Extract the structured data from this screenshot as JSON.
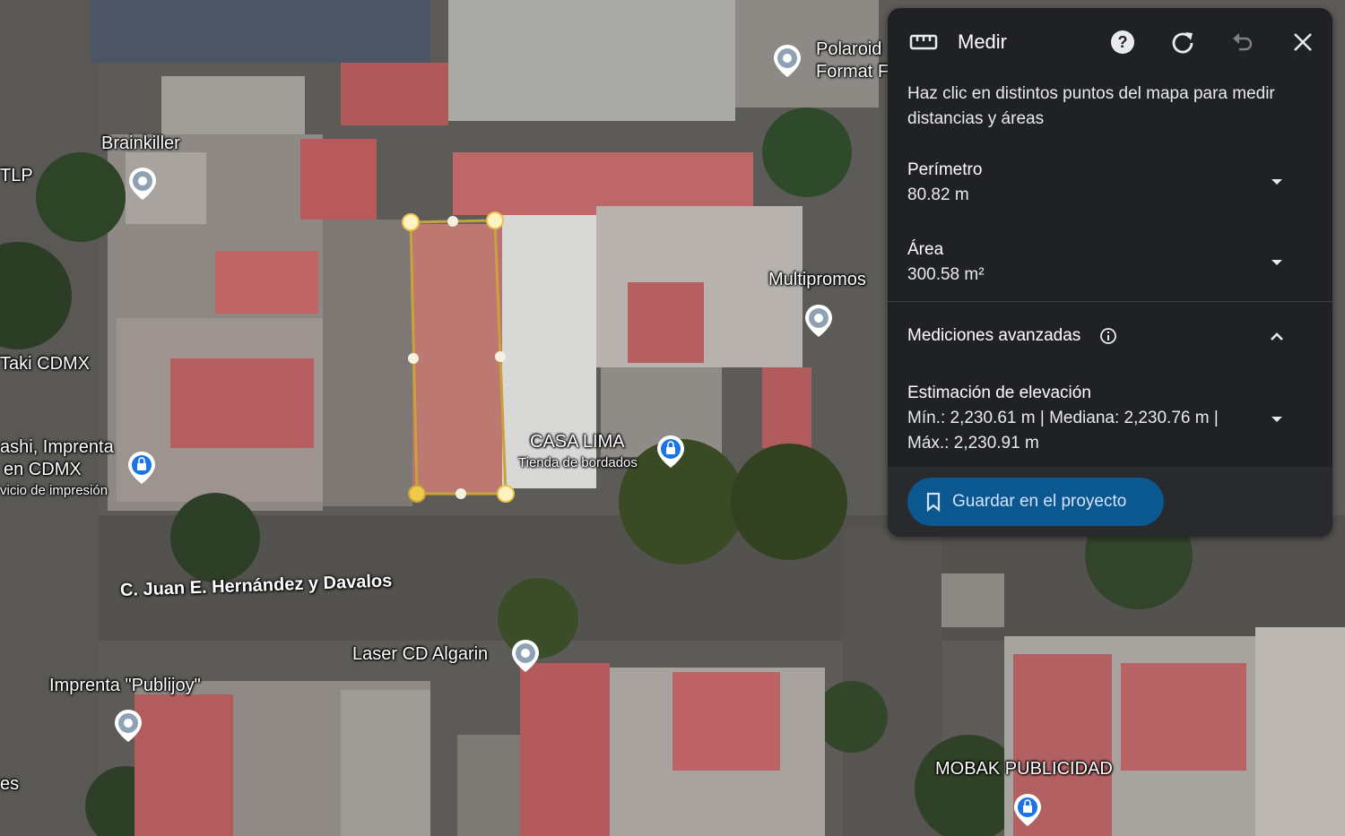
{
  "map_labels": {
    "polaroid_1": "Polaroid",
    "polaroid_2": "Format F",
    "brainkiller": "Brainkiller",
    "tlp": "TLP",
    "multipromos": "Multipromos",
    "taki": "Taki CDMX",
    "ashi_1": "ashi, Imprenta",
    "ashi_2": "en CDMX",
    "ashi_3": "vicio de impresión",
    "casa_lima": "CASA LIMA",
    "casa_lima_sub": "Tienda de bordados",
    "street": "C. Juan E. Hernández y Davalos",
    "laser": "Laser CD Algarin",
    "publijoy": "Imprenta \"Publijoy\"",
    "es": "es",
    "mobak": "MOBAK PUBLICIDAD"
  },
  "panel": {
    "title": "Medir",
    "instructions": "Haz clic en distintos puntos del mapa para medir distancias y áreas",
    "perimeter_label": "Perímetro",
    "perimeter_value": "80.82 m",
    "area_label": "Área",
    "area_value": "300.58 m²",
    "advanced_label": "Mediciones avanzadas",
    "elevation_label": "Estimación de elevación",
    "elevation_line1": "Mín.: 2,230.61 m | Mediana: 2,230.76 m |",
    "elevation_line2": "Máx.: 2,230.91 m",
    "save_label": "Guardar en el proyecto"
  },
  "colors": {
    "panel_bg": "#202124",
    "accent_button": "#0b5790",
    "measure_line": "#f2c94c"
  },
  "icons": [
    "ruler-icon",
    "help-icon",
    "refresh-icon",
    "undo-icon",
    "close-icon",
    "chevron-down-icon",
    "chevron-up-icon",
    "info-icon",
    "bookmark-icon",
    "place-pin-icon",
    "shopping-bag-pin-icon"
  ]
}
